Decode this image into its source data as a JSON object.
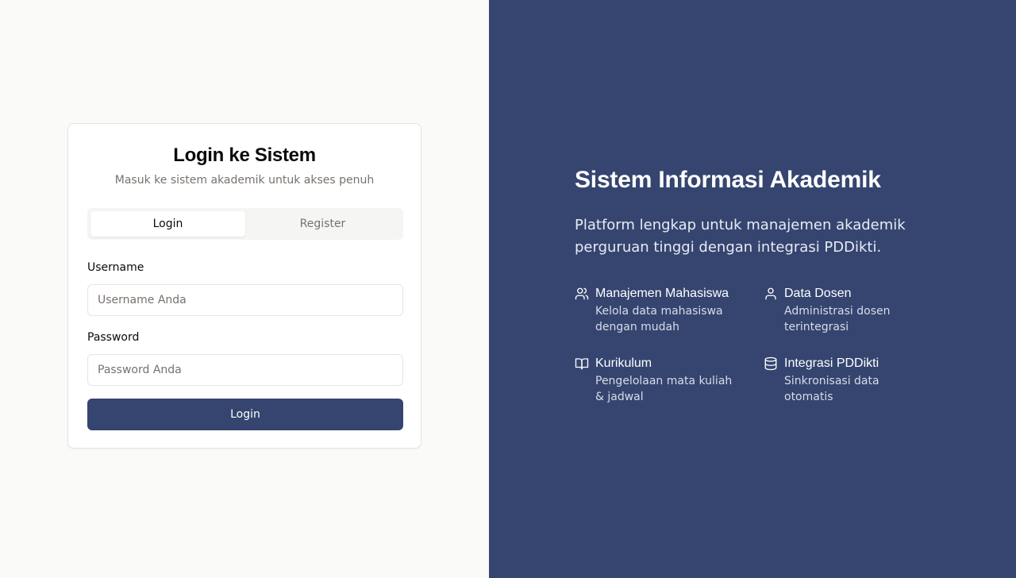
{
  "login_card": {
    "title": "Login ke Sistem",
    "subtitle": "Masuk ke sistem akademik untuk akses penuh",
    "tabs": [
      {
        "label": "Login",
        "active": true
      },
      {
        "label": "Register",
        "active": false
      }
    ],
    "username": {
      "label": "Username",
      "placeholder": "Username Anda",
      "value": ""
    },
    "password": {
      "label": "Password",
      "placeholder": "Password Anda",
      "value": ""
    },
    "submit_label": "Login"
  },
  "hero": {
    "title": "Sistem Informasi Akademik",
    "description": "Platform lengkap untuk manajemen akademik perguruan tinggi dengan integrasi PDDikti.",
    "features": [
      {
        "icon": "users-icon",
        "title": "Manajemen Mahasiswa",
        "description": "Kelola data mahasiswa dengan mudah"
      },
      {
        "icon": "user-icon",
        "title": "Data Dosen",
        "description": "Administrasi dosen terintegrasi"
      },
      {
        "icon": "book-open-icon",
        "title": "Kurikulum",
        "description": "Pengelolaan mata kuliah & jadwal"
      },
      {
        "icon": "database-icon",
        "title": "Integrasi PDDikti",
        "description": "Sinkronisasi data otomatis"
      }
    ]
  },
  "colors": {
    "primary": "#354570",
    "left_background": "#fafaf9",
    "muted_text": "#78716c"
  }
}
